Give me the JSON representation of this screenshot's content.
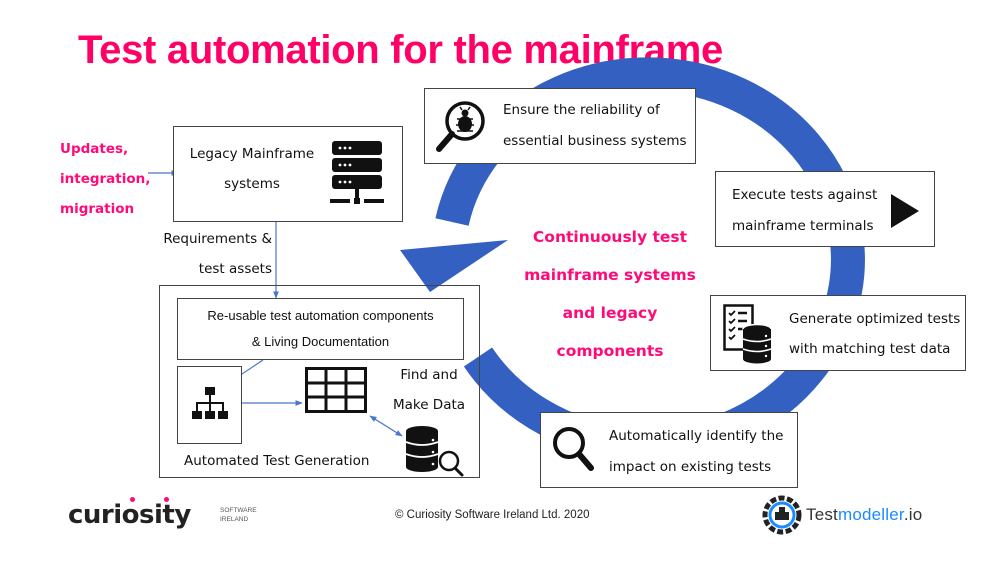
{
  "title": "Test automation for the mainframe",
  "colors": {
    "accent": "#ff0a78",
    "cycle_arrow": "#3461c1",
    "connector": "#4a78c8",
    "border": "#444444",
    "testmodeller_blue": "#1a8cff"
  },
  "inputs_label": {
    "lines": [
      "Updates,",
      "integration,",
      "migration"
    ]
  },
  "legacy_box": {
    "lines": [
      "Legacy Mainframe",
      "systems"
    ],
    "icon": "server-icon"
  },
  "requirements_label": {
    "lines": [
      "Requirements &",
      "test assets"
    ]
  },
  "automation_group": {
    "reusable_box": {
      "lines": [
        "Re-usable test automation components",
        "& Living Documentation"
      ]
    },
    "hierarchy_icon": "hierarchy-icon",
    "table_icon": "table-grid-icon",
    "find_make_data": [
      "Find and",
      "Make Data"
    ],
    "database_search_icon": "database-search-icon",
    "caption": "Automated Test Generation"
  },
  "cycle": {
    "center_text": [
      "Continuously test",
      "mainframe systems",
      "and legacy",
      "components"
    ],
    "steps": [
      {
        "icon": "bug-search-icon",
        "lines": [
          "Ensure the reliability of",
          "essential business systems"
        ]
      },
      {
        "icon": "play-icon",
        "lines": [
          "Execute tests against",
          "mainframe terminals"
        ]
      },
      {
        "icon": "checklist-database-icon",
        "lines": [
          "Generate optimized tests",
          "with matching test data"
        ]
      },
      {
        "icon": "magnifier-icon",
        "lines": [
          "Automatically identify the",
          "impact on existing tests"
        ]
      }
    ]
  },
  "footer": {
    "curiosity_logo": {
      "word": "curiosity",
      "sub1": "SOFTWARE",
      "sub2": "IRELAND"
    },
    "copyright": "© Curiosity Software Ireland Ltd. 2020",
    "testmodeller_logo": {
      "part1": "Test",
      "part2": "modeller",
      "part3": ".io"
    }
  }
}
